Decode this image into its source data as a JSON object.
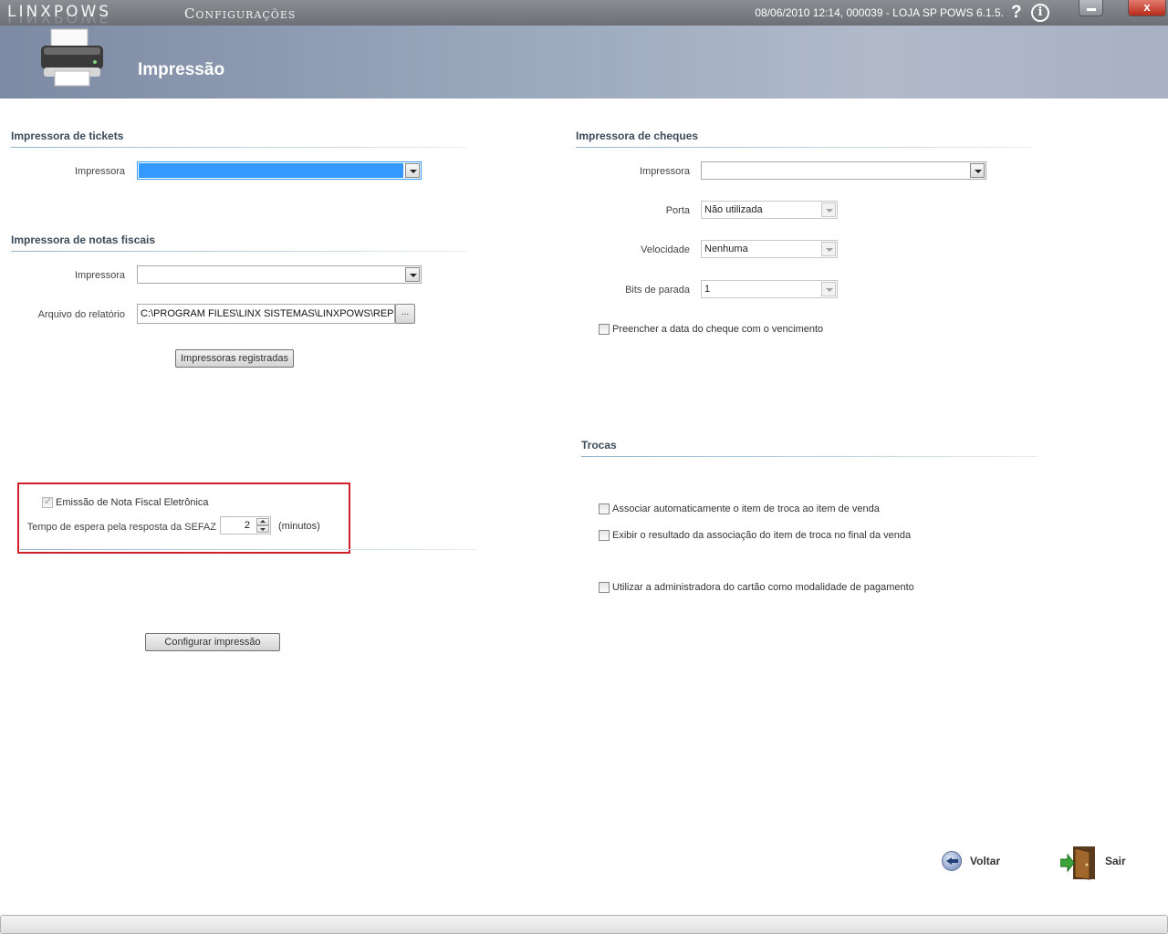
{
  "titlebar": {
    "brand": "LINXPOWS",
    "app_title": "Configurações",
    "status": "08/06/2010 12:14, 000039 - LOJA SP POWS 6.1.5.",
    "help": "?",
    "info": "i",
    "close": "x"
  },
  "header": {
    "title": "Impressão",
    "icon": "printer-icon"
  },
  "tickets": {
    "title": "Impressora de tickets",
    "printer_label": "Impressora",
    "printer_value": ""
  },
  "fiscal": {
    "title": "Impressora de notas fiscais",
    "printer_label": "Impressora",
    "printer_value": "",
    "report_label": "Arquivo do relatório",
    "report_value": "C:\\PROGRAM FILES\\LINX SISTEMAS\\LINXPOWS\\REPORTS",
    "browse_label": "...",
    "registered_button": "Impressoras registradas"
  },
  "nfe": {
    "emission_label": "Emissão de Nota Fiscal Eletrônica",
    "emission_checked": true,
    "wait_label": "Tempo de espera pela resposta da SEFAZ",
    "wait_value": "2",
    "wait_unit": "(minutos)",
    "configure_button": "Configurar impressão"
  },
  "cheques": {
    "title": "Impressora de cheques",
    "printer_label": "Impressora",
    "printer_value": "",
    "port_label": "Porta",
    "port_value": "Não utilizada",
    "speed_label": "Velocidade",
    "speed_value": "Nenhuma",
    "stopbits_label": "Bits de parada",
    "stopbits_value": "1",
    "fill_date_label": "Preencher a data do cheque com o vencimento",
    "fill_date_checked": false
  },
  "trocas": {
    "title": "Trocas",
    "assoc_label": "Associar automaticamente o item de troca ao item de venda",
    "result_label": "Exibir o resultado da associação do item de troca no final da venda",
    "card_label": "Utilizar a administradora do cartão como modalidade de pagamento"
  },
  "actions": {
    "back_label": "Voltar",
    "exit_label": "Sair"
  },
  "colors": {
    "selection": "#3399ff",
    "highlight_border": "#d0202c",
    "header_band": "#98a5bb"
  }
}
